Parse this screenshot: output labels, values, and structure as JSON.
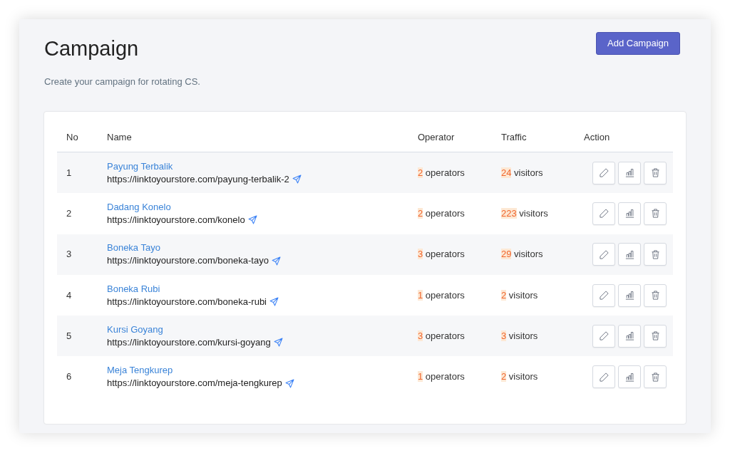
{
  "page": {
    "title": "Campaign",
    "subtitle": "Create your campaign for rotating CS.",
    "add_button": "Add Campaign"
  },
  "table": {
    "columns": [
      "No",
      "Name",
      "Operator",
      "Traffic",
      "Action"
    ],
    "rows": [
      {
        "no": "1",
        "name": "Payung Terbalik",
        "url": "https://linktoyourstore.com/payung-terbalik-2",
        "operators": {
          "count": "2",
          "unit": "operators"
        },
        "traffic": {
          "count": "24",
          "unit": "visitors"
        }
      },
      {
        "no": "2",
        "name": "Dadang Konelo",
        "url": "https://linktoyourstore.com/konelo",
        "operators": {
          "count": "2",
          "unit": "operators"
        },
        "traffic": {
          "count": "223",
          "unit": "visitors"
        }
      },
      {
        "no": "3",
        "name": "Boneka Tayo",
        "url": "https://linktoyourstore.com/boneka-tayo",
        "operators": {
          "count": "3",
          "unit": "operators"
        },
        "traffic": {
          "count": "29",
          "unit": "visitors"
        }
      },
      {
        "no": "4",
        "name": "Boneka Rubi",
        "url": "https://linktoyourstore.com/boneka-rubi",
        "operators": {
          "count": "1",
          "unit": "operators"
        },
        "traffic": {
          "count": "2",
          "unit": "visitors"
        }
      },
      {
        "no": "5",
        "name": "Kursi Goyang",
        "url": "https://linktoyourstore.com/kursi-goyang",
        "operators": {
          "count": "3",
          "unit": "operators"
        },
        "traffic": {
          "count": "3",
          "unit": "visitors"
        }
      },
      {
        "no": "6",
        "name": "Meja Tengkurep",
        "url": "https://linktoyourstore.com/meja-tengkurep",
        "operators": {
          "count": "1",
          "unit": "operators"
        },
        "traffic": {
          "count": "2",
          "unit": "visitors"
        }
      }
    ]
  }
}
